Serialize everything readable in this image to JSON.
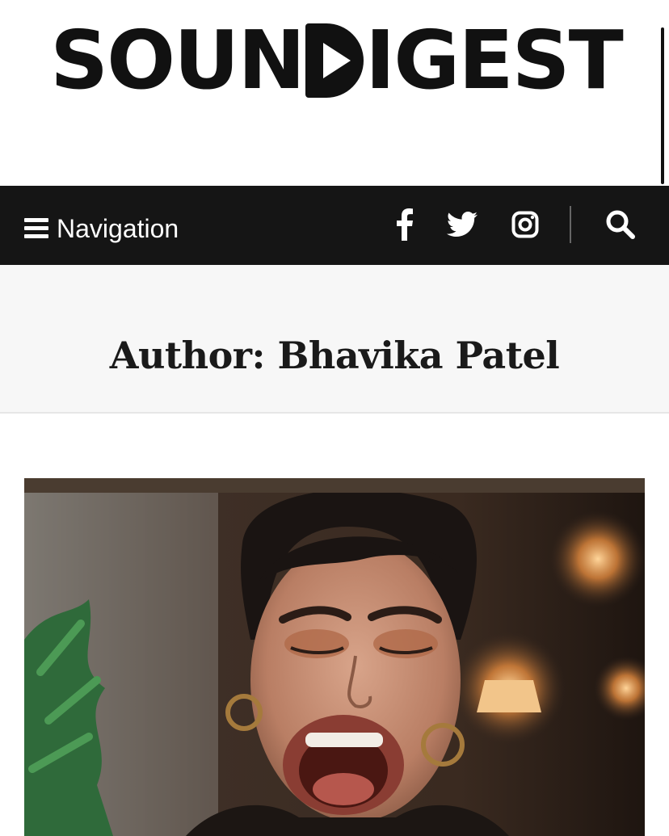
{
  "site": {
    "logo_text_left": "SOUN",
    "logo_text_right": "IGEST"
  },
  "nav": {
    "toggle_label": "Navigation",
    "icons": [
      "facebook-icon",
      "twitter-icon",
      "instagram-icon",
      "search-icon"
    ]
  },
  "archive": {
    "title": "Author: Bhavika Patel"
  },
  "colors": {
    "nav_background": "#151515",
    "banner_background": "#f7f7f7",
    "text": "#1a1a1a"
  }
}
